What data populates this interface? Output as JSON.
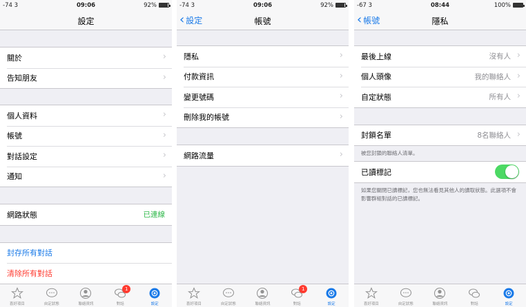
{
  "screens": [
    {
      "status": {
        "left": "-74 3",
        "time": "09:06",
        "battery": "92%",
        "battery_level": 0.92
      },
      "nav": {
        "title": "設定",
        "back": ""
      },
      "groups": [
        [
          {
            "label": "關於"
          },
          {
            "label": "告知朋友"
          }
        ],
        [
          {
            "label": "個人資料"
          },
          {
            "label": "帳號"
          },
          {
            "label": "對話設定"
          },
          {
            "label": "通知"
          }
        ],
        [
          {
            "label": "網路狀態",
            "status": "已連線"
          }
        ],
        [
          {
            "label": "封存所有對話"
          },
          {
            "label": "清除所有對話"
          }
        ]
      ],
      "tabs": [
        {
          "label": "喜好項目"
        },
        {
          "label": "自定狀態"
        },
        {
          "label": "聯絡資訊"
        },
        {
          "label": "對話",
          "badge": "1"
        },
        {
          "label": "設定"
        }
      ]
    },
    {
      "status": {
        "left": "-74 3",
        "time": "09:06",
        "battery": "92%",
        "battery_level": 0.92
      },
      "nav": {
        "title": "帳號",
        "back": "設定"
      },
      "groups": [
        [
          {
            "label": "隱私"
          },
          {
            "label": "付款資訊"
          },
          {
            "label": "變更號碼"
          },
          {
            "label": "刪除我的帳號"
          }
        ],
        [
          {
            "label": "網路流量"
          }
        ]
      ],
      "tabs": [
        {
          "label": "喜好項目"
        },
        {
          "label": "自定狀態"
        },
        {
          "label": "聯絡資訊"
        },
        {
          "label": "對話",
          "badge": "1"
        },
        {
          "label": "設定"
        }
      ]
    },
    {
      "status": {
        "left": "-67 3",
        "time": "08:44",
        "battery": "100%",
        "battery_level": 1.0
      },
      "nav": {
        "title": "隱私",
        "back": "帳號"
      },
      "groups": [
        [
          {
            "label": "最後上線",
            "value": "沒有人"
          },
          {
            "label": "個人頭像",
            "value": "我的聯絡人"
          },
          {
            "label": "自定狀態",
            "value": "所有人"
          }
        ],
        [
          {
            "label": "封鎖名單",
            "value": "8名聯絡人"
          }
        ],
        [
          {
            "label": "已讀標記",
            "toggle": true
          }
        ]
      ],
      "notes": {
        "blocked": "被您封鎖的聯絡人清單。",
        "read_receipts": "如果您關閉已讀標記，您也無法看見其他人的讀取狀態。此選項不會影響群組對話的已讀標記。"
      },
      "tabs": [
        {
          "label": "喜好項目"
        },
        {
          "label": "自定狀態"
        },
        {
          "label": "聯絡資訊"
        },
        {
          "label": "對話"
        },
        {
          "label": "設定"
        }
      ]
    }
  ],
  "chevron": "›"
}
